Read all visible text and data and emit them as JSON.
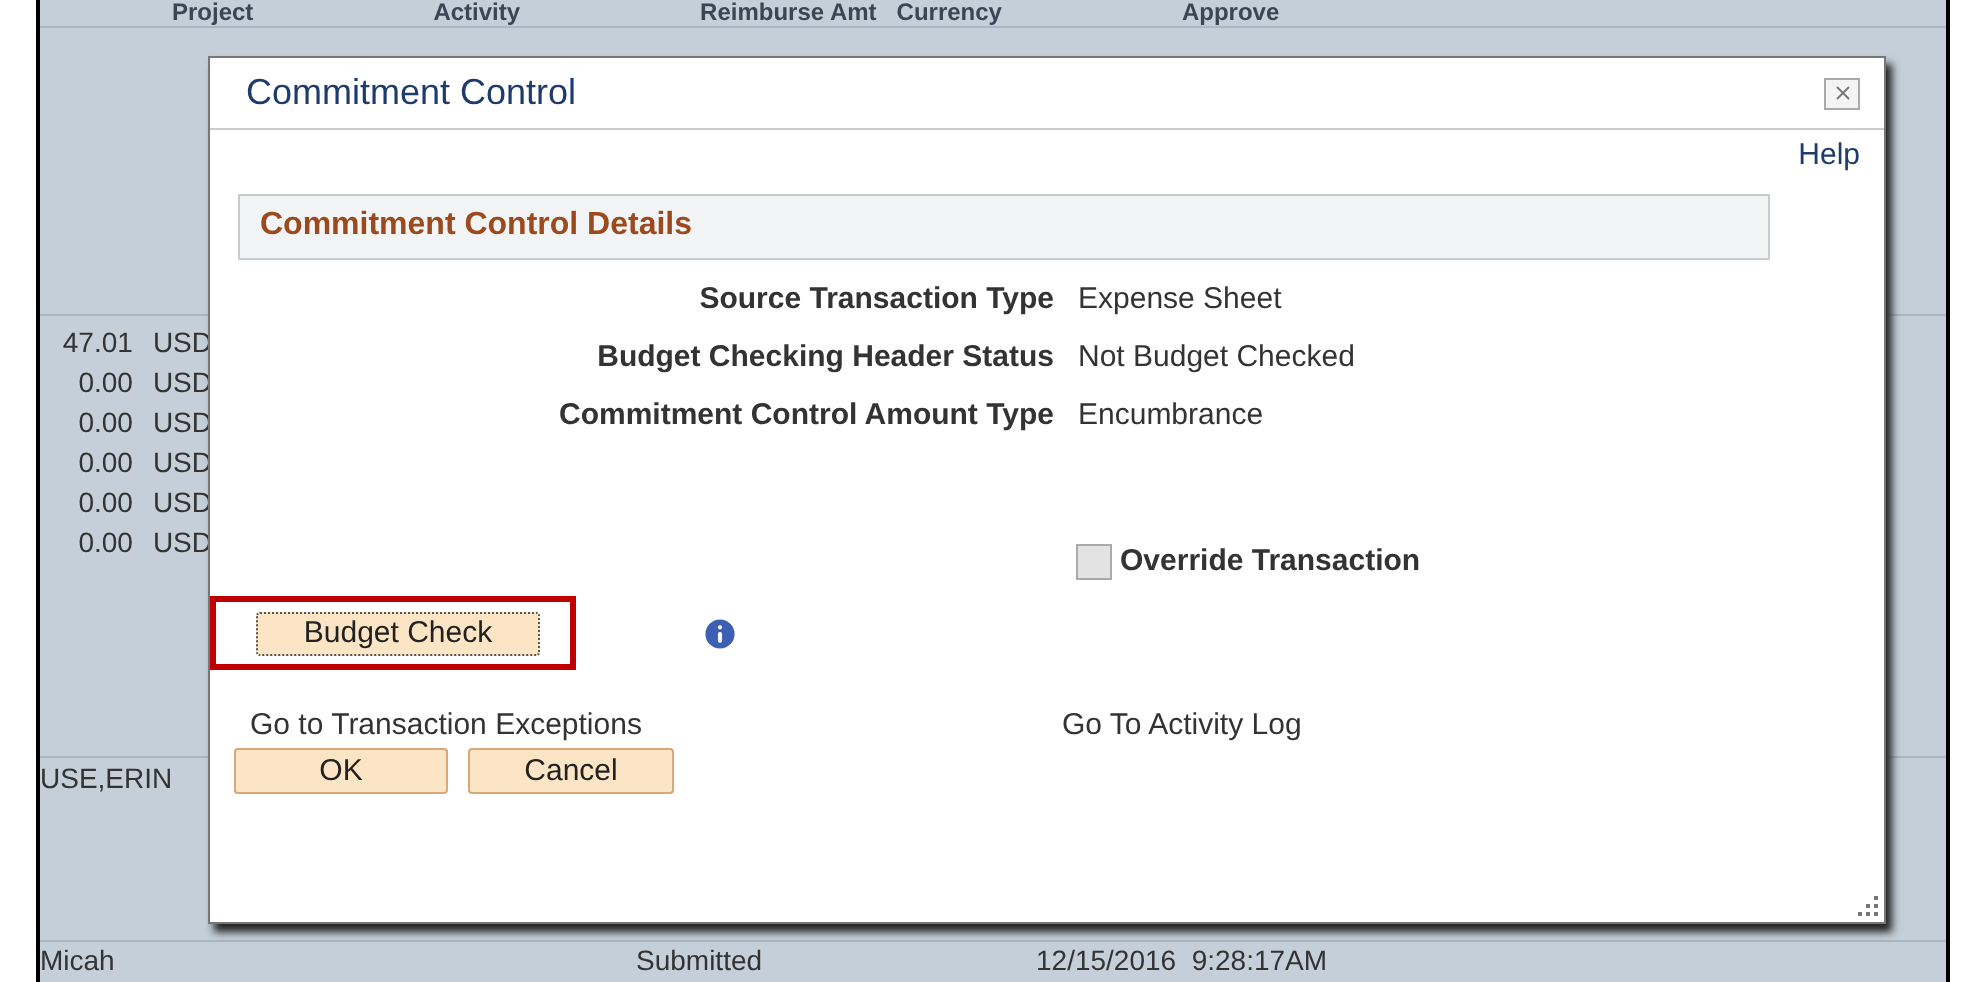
{
  "background": {
    "columns": [
      "Project",
      "Activity",
      "Reimburse Amt",
      "Currency",
      "Approve"
    ],
    "amounts": [
      {
        "amount": "47.01",
        "currency": "USD"
      },
      {
        "amount": "0.00",
        "currency": "USD"
      },
      {
        "amount": "0.00",
        "currency": "USD"
      },
      {
        "amount": "0.00",
        "currency": "USD"
      },
      {
        "amount": "0.00",
        "currency": "USD"
      },
      {
        "amount": "0.00",
        "currency": "USD"
      }
    ],
    "name_cell": "USE,ERIN",
    "bottom_row": [
      "Micah",
      "Submitted",
      "12/15/2016  9:28:17AM"
    ]
  },
  "dialog": {
    "title": "Commitment Control",
    "help_link": "Help",
    "section_title": "Commitment Control Details",
    "fields": [
      {
        "label": "Source Transaction Type",
        "value": "Expense Sheet"
      },
      {
        "label": "Budget Checking Header Status",
        "value": "Not Budget Checked"
      },
      {
        "label": "Commitment Control Amount Type",
        "value": "Encumbrance"
      }
    ],
    "override": {
      "label": "Override Transaction",
      "checked": false
    },
    "budget_check_button": "Budget Check",
    "links": [
      "Go to Transaction Exceptions",
      "Go To Activity Log"
    ],
    "buttons": [
      "OK",
      "Cancel"
    ]
  }
}
